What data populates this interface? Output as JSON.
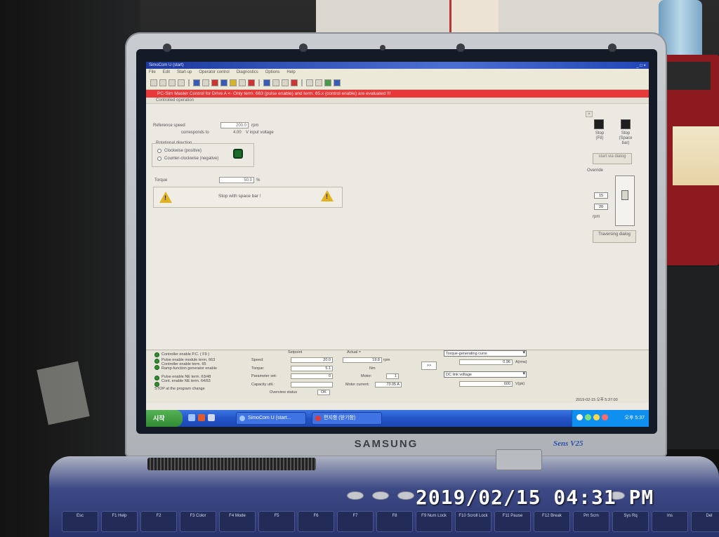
{
  "window": {
    "title": "SimoCom U (start)",
    "menus": [
      "File",
      "Edit",
      "Start-up",
      "Operator control",
      "Diagnostics",
      "Options",
      "Help"
    ]
  },
  "warning_banner": "PC-Sim Master Control for Drive A <- Only term. 663 (pulse enable) and term. 65.x (control enable) are evaluated !!!",
  "subtitle": "Controlled operation",
  "control": {
    "reference_speed_label": "Reference speed",
    "reference_speed_value": "200.0",
    "reference_speed_unit": "rpm",
    "corresponds_label": "corresponds to",
    "corresponds_value": "4.00",
    "corresponds_unit": "V input voltage",
    "rotation_title": "Rotational direction",
    "rotation_cw": "Clockwise (positive)",
    "rotation_ccw": "Counter-clockwise (negative)",
    "torque_label": "Torque",
    "torque_value": "50.0",
    "torque_unit": "%",
    "stop_text": "Stop with space bar !"
  },
  "side_panel": {
    "stop_label": "Stop (F8)",
    "stop_space_label": "Stop (Space bar)",
    "start_label": "start via dialog",
    "override_label": "Override",
    "override_top": "15",
    "override_bottom": "20",
    "override_unit": "rpm",
    "traversing_label": "Traversing dialog"
  },
  "status": {
    "rows": [
      "Controller enable P.C. ( F9 )",
      "Pulse enable module term. 663",
      "Controller enable term. 65",
      "Ramp-function generator enable",
      "Pulse enable NE term. 63/48",
      "Cont. enable NE term. 64/63",
      "STOP at the program change"
    ],
    "setpoint_label": "Setpoint",
    "actual_label": "Actual =",
    "speed_label": "Speed:",
    "speed_setpoint": "20.0",
    "speed_actual": "19.8",
    "speed_unit": "rpm",
    "torque_label": "Torque:",
    "torque_setpoint": "5.1",
    "torque_unit": "Nm",
    "param_label": "Parameter set:",
    "param_setpoint": "0",
    "motor_label": "Motor:",
    "motor_value": "1",
    "capacity_label": "Capacity util.:",
    "motor_current_label": "Motor current:",
    "motor_current_value": "73.05 A",
    "overview_label": "Overview status",
    "overview_button": "OK",
    "arrow_button": ">>",
    "dropdown1": "Torque-generating curre",
    "dropdown1_value": "0.96",
    "dropdown1_unit": "A(rms)",
    "dropdown2": "DC link voltage",
    "dropdown2_value": "600",
    "dropdown2_unit": "V(pk)",
    "footer_time": "2019-02-15 오후 5:37:00"
  },
  "taskbar": {
    "start": "시작",
    "task1": "SimoCom U (start...",
    "task2": "편지함 (받기함)",
    "clock": "오후 5:37"
  },
  "laptop": {
    "brand": "SAMSUNG",
    "model": "Sens V25"
  },
  "keyboard": [
    "Esc",
    "F1 Help",
    "F2",
    "F3 Color",
    "F4 Mode",
    "F5",
    "F6",
    "F7",
    "F8",
    "F9 Num Lock",
    "F10 Scroll Lock",
    "F11 Pause",
    "F12 Break",
    "Prt Scrn",
    "Sys Rq",
    "Ins",
    "Del"
  ],
  "camera_timestamp": "2019/02/15  04:31 PM"
}
